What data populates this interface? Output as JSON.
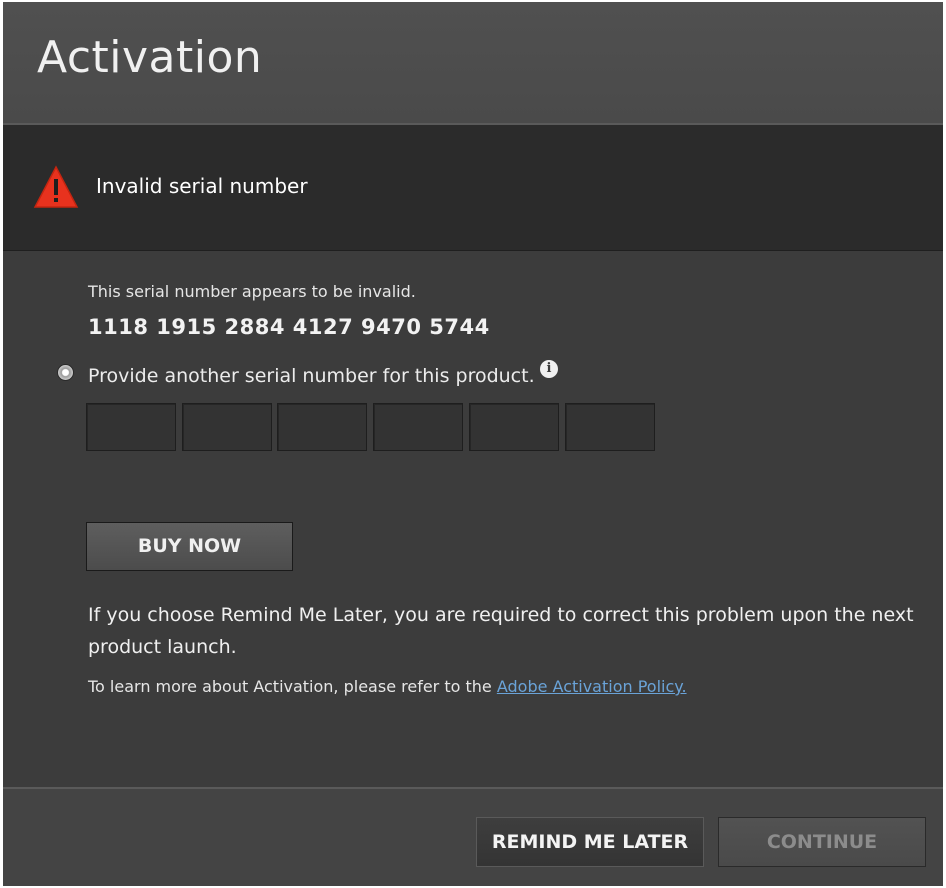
{
  "window": {
    "title": "Activation"
  },
  "error": {
    "icon": "warning-triangle-icon",
    "message": "Invalid serial number"
  },
  "main": {
    "description": "This serial number appears to be invalid.",
    "serial_number": "1118 1915 2884 4127 9470 5744",
    "radio_label": "Provide another serial number for this product.",
    "radio_selected": true,
    "info_icon": "info-icon",
    "serial_inputs": [
      "",
      "",
      "",
      "",
      "",
      ""
    ],
    "buy_now_label": "BUY NOW",
    "remind_notice": "If you choose Remind Me Later, you are required to correct this problem upon the next product launch.",
    "learn_more_prefix": "To learn more about Activation, please refer to the ",
    "policy_link_label": "Adobe Activation Policy."
  },
  "footer": {
    "remind_label": "REMIND ME LATER",
    "continue_label": "CONTINUE",
    "continue_enabled": false
  },
  "colors": {
    "background": "#3c3c3c",
    "titlebar": "#4e4e4e",
    "error_bar": "#2b2b2b",
    "warning_red": "#e8321e",
    "link": "#6aa3d8"
  }
}
